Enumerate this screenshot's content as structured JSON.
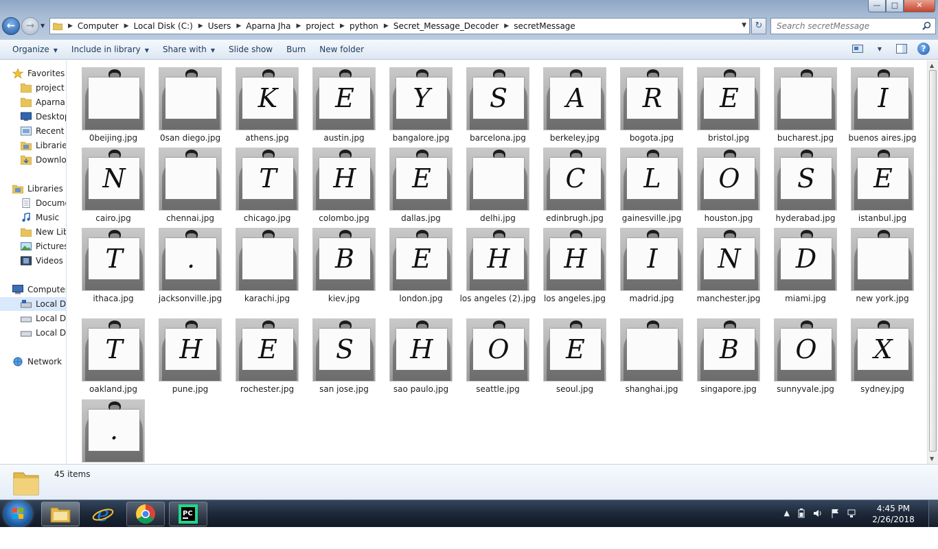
{
  "window": {
    "minimize": "—",
    "maximize": "□",
    "close": "✕"
  },
  "address": {
    "crumbs": [
      "Computer",
      "Local Disk (C:)",
      "Users",
      "Aparna Jha",
      "project",
      "python",
      "Secret_Message_Decoder",
      "secretMessage"
    ]
  },
  "search": {
    "placeholder": "Search secretMessage"
  },
  "toolbar": {
    "organize": "Organize",
    "include_in_library": "Include in library",
    "share_with": "Share with",
    "slide_show": "Slide show",
    "burn": "Burn",
    "new_folder": "New folder"
  },
  "navpane": {
    "favorites": "Favorites",
    "project": "project",
    "aparna": "Aparna J",
    "desktop": "Desktop",
    "recent": "Recent P",
    "libraries_fav": "Libraries",
    "downloads": "Downloa",
    "libraries": "Libraries",
    "documents": "Docume",
    "music": "Music",
    "new_library": "New Libr",
    "pictures": "Pictures",
    "videos": "Videos",
    "computer": "Computer",
    "local_disk_1": "Local Dis",
    "local_disk_2": "Local Dis",
    "local_disk_3": "Local Dis",
    "network": "Network"
  },
  "files": [
    {
      "name": "0beijing.jpg",
      "letter": ""
    },
    {
      "name": "0san diego.jpg",
      "letter": ""
    },
    {
      "name": "athens.jpg",
      "letter": "K"
    },
    {
      "name": "austin.jpg",
      "letter": "E"
    },
    {
      "name": "bangalore.jpg",
      "letter": "Y"
    },
    {
      "name": "barcelona.jpg",
      "letter": "S"
    },
    {
      "name": "berkeley.jpg",
      "letter": "A"
    },
    {
      "name": "bogota.jpg",
      "letter": "R"
    },
    {
      "name": "bristol.jpg",
      "letter": "E"
    },
    {
      "name": "bucharest.jpg",
      "letter": ""
    },
    {
      "name": "buenos aires.jpg",
      "letter": "I"
    },
    {
      "name": "cairo.jpg",
      "letter": "N"
    },
    {
      "name": "chennai.jpg",
      "letter": ""
    },
    {
      "name": "chicago.jpg",
      "letter": "T"
    },
    {
      "name": "colombo.jpg",
      "letter": "H"
    },
    {
      "name": "dallas.jpg",
      "letter": "E"
    },
    {
      "name": "delhi.jpg",
      "letter": ""
    },
    {
      "name": "edinbrugh.jpg",
      "letter": "C"
    },
    {
      "name": "gainesville.jpg",
      "letter": "L"
    },
    {
      "name": "houston.jpg",
      "letter": "O"
    },
    {
      "name": "hyderabad.jpg",
      "letter": "S"
    },
    {
      "name": "istanbul.jpg",
      "letter": "E"
    },
    {
      "name": "ithaca.jpg",
      "letter": "T"
    },
    {
      "name": "jacksonville.jpg",
      "letter": "."
    },
    {
      "name": "karachi.jpg",
      "letter": ""
    },
    {
      "name": "kiev.jpg",
      "letter": "B"
    },
    {
      "name": "london.jpg",
      "letter": "E"
    },
    {
      "name": "los angeles (2).jpg",
      "letter": "H"
    },
    {
      "name": "los angeles.jpg",
      "letter": "H"
    },
    {
      "name": "madrid.jpg",
      "letter": "I"
    },
    {
      "name": "manchester.jpg",
      "letter": "N"
    },
    {
      "name": "miami.jpg",
      "letter": "D"
    },
    {
      "name": "new york.jpg",
      "letter": ""
    },
    {
      "name": "oakland.jpg",
      "letter": "T"
    },
    {
      "name": "pune.jpg",
      "letter": "H"
    },
    {
      "name": "rochester.jpg",
      "letter": "E"
    },
    {
      "name": "san jose.jpg",
      "letter": "S"
    },
    {
      "name": "sao paulo.jpg",
      "letter": "H"
    },
    {
      "name": "seattle.jpg",
      "letter": "O"
    },
    {
      "name": "seoul.jpg",
      "letter": "E"
    },
    {
      "name": "shanghai.jpg",
      "letter": ""
    },
    {
      "name": "singapore.jpg",
      "letter": "B"
    },
    {
      "name": "sunnyvale.jpg",
      "letter": "O"
    },
    {
      "name": "sydney.jpg",
      "letter": "X"
    },
    {
      "name": "",
      "letter": "."
    }
  ],
  "details": {
    "count": "45 items"
  },
  "taskbar": {
    "time": "4:45 PM",
    "date": "2/26/2018",
    "tray_up": "▲"
  }
}
